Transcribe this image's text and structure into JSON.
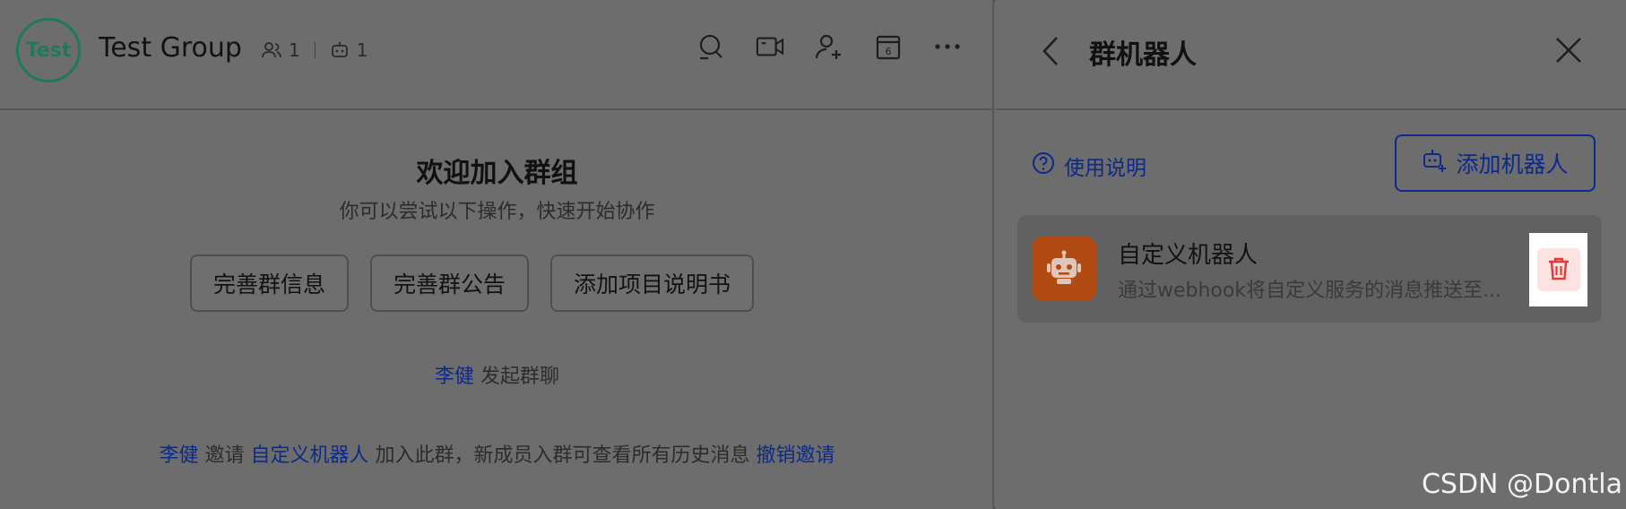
{
  "chat": {
    "avatar_text": "Test",
    "title": "Test Group",
    "member_count": "1",
    "bot_count": "1",
    "tools": [
      "search-icon",
      "video-icon",
      "add-member-icon",
      "calendar-icon",
      "more-icon"
    ],
    "calendar_day": "6",
    "welcome_title": "欢迎加入群组",
    "welcome_subtitle": "你可以尝试以下操作，快速开始协作",
    "actions": [
      "完善群信息",
      "完善群公告",
      "添加项目说明书"
    ],
    "event_started": {
      "user": "李健",
      "text": "发起群聊"
    },
    "event_invite": {
      "user": "李健",
      "verb": "邀请",
      "target": "自定义机器人",
      "text": "加入此群，新成员入群可查看所有历史消息",
      "undo": "撤销邀请"
    }
  },
  "panel": {
    "title": "群机器人",
    "help_label": "使用说明",
    "add_button_label": "添加机器人",
    "robot": {
      "name": "自定义机器人",
      "description": "通过webhook将自定义服务的消息推送至..."
    }
  },
  "colors": {
    "accent": "#0d2a88",
    "avatar_ring": "#1f7a5a",
    "robot_avatar": "#b24a14",
    "delete_icon": "#e53935"
  },
  "watermark": "CSDN @Dontla"
}
